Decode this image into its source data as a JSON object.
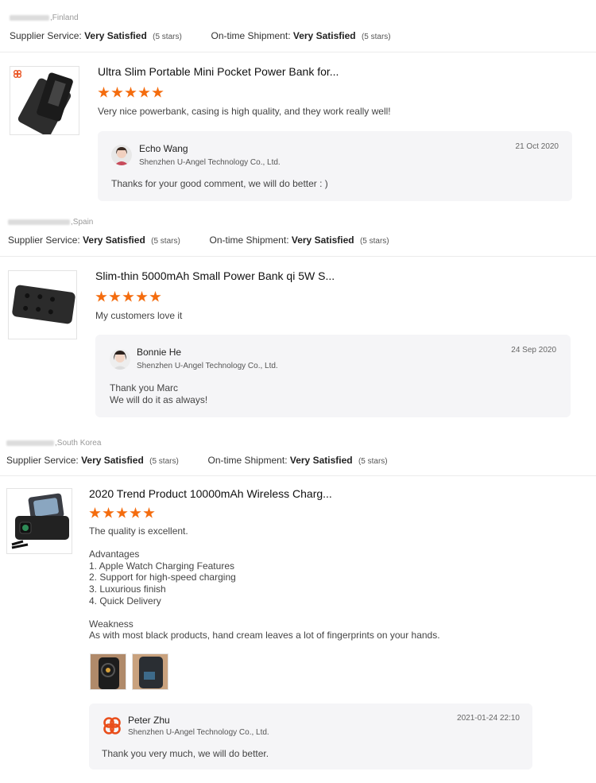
{
  "accent_color": "#f46c0e",
  "labels": {
    "supplier_service": "Supplier Service:",
    "ontime_shipment": "On-time Shipment:"
  },
  "reviews": [
    {
      "country": "Finland",
      "supplier_rating": "Very Satisfied",
      "supplier_stars": "(5 stars)",
      "shipment_rating": "Very Satisfied",
      "shipment_stars": "(5 stars)",
      "product_title": "Ultra Slim Portable Mini Pocket Power Bank for...",
      "rating": 5,
      "comment": "Very nice powerbank, casing is high quality, and they work really well!",
      "reply": {
        "name": "Echo Wang",
        "company": "Shenzhen U-Angel Technology Co., Ltd.",
        "date": "21 Oct 2020",
        "text": "Thanks for your good comment, we will do better : )"
      }
    },
    {
      "country": "Spain",
      "supplier_rating": "Very Satisfied",
      "supplier_stars": "(5 stars)",
      "shipment_rating": "Very Satisfied",
      "shipment_stars": "(5 stars)",
      "product_title": "Slim-thin 5000mAh Small Power Bank qi 5W S...",
      "rating": 5,
      "comment": "My customers love it",
      "reply": {
        "name": "Bonnie He",
        "company": "Shenzhen U-Angel Technology Co., Ltd.",
        "date": "24 Sep 2020",
        "text": "Thank you Marc\nWe will do it as always!"
      }
    },
    {
      "country": "South Korea",
      "supplier_rating": "Very Satisfied",
      "supplier_stars": "(5 stars)",
      "shipment_rating": "Very Satisfied",
      "shipment_stars": "(5 stars)",
      "product_title": "2020 Trend Product 10000mAh Wireless Charg...",
      "rating": 5,
      "comment": "The quality is excellent.\n\nAdvantages\n1. Apple Watch Charging Features\n2. Support for high-speed charging\n3. Luxurious finish\n4. Quick Delivery\n\nWeakness\nAs with most black products, hand cream leaves a lot of fingerprints on your hands.",
      "reply": {
        "name": "Peter Zhu",
        "company": "Shenzhen U-Angel Technology Co., Ltd.",
        "date": "2021-01-24 22:10",
        "text": "Thank you very much, we will do better."
      }
    }
  ]
}
